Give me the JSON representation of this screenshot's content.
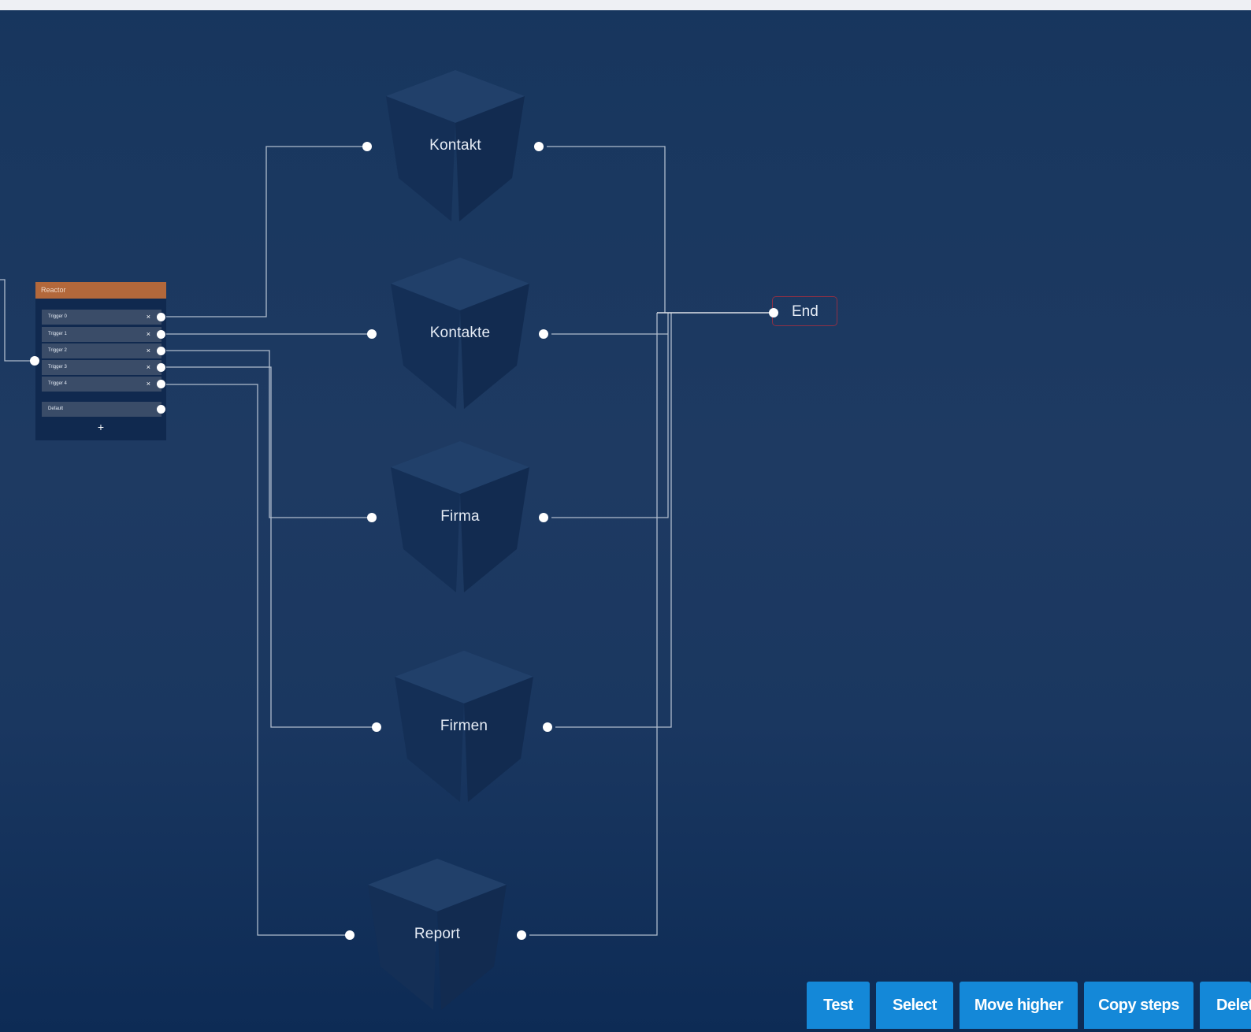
{
  "reactor": {
    "title": "Reactor",
    "triggers": [
      "Trigger 0",
      "Trigger 1",
      "Trigger 2",
      "Trigger 3",
      "Trigger 4"
    ],
    "remove_label": "×",
    "default_label": "Default",
    "add_label": "+"
  },
  "nodes": {
    "kontakt": "Kontakt",
    "kontakte": "Kontakte",
    "firma": "Firma",
    "firmen": "Firmen",
    "report": "Report"
  },
  "end_node": {
    "label": "End",
    "border_color": "#8e3045"
  },
  "toolbar": {
    "test": "Test",
    "select": "Select",
    "move_higher": "Move higher",
    "copy_steps": "Copy steps",
    "delete": "Delete"
  },
  "colors": {
    "toolbar_button": "#1488d8",
    "reactor_header": "#b3683b",
    "connector": "#c9d3e0",
    "background": "#1a3760"
  }
}
